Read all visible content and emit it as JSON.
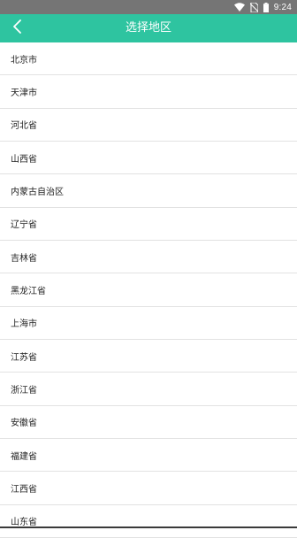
{
  "status_bar": {
    "time": "9:24",
    "icons": [
      "wifi-icon",
      "no-sim-icon",
      "battery-icon"
    ]
  },
  "app_bar": {
    "title": "选择地区",
    "back_icon": "chevron-left-icon",
    "color": "#2ec4a0"
  },
  "regions": [
    "北京市",
    "天津市",
    "河北省",
    "山西省",
    "内蒙古自治区",
    "辽宁省",
    "吉林省",
    "黑龙江省",
    "上海市",
    "江苏省",
    "浙江省",
    "安徽省",
    "福建省",
    "江西省",
    "山东省"
  ]
}
